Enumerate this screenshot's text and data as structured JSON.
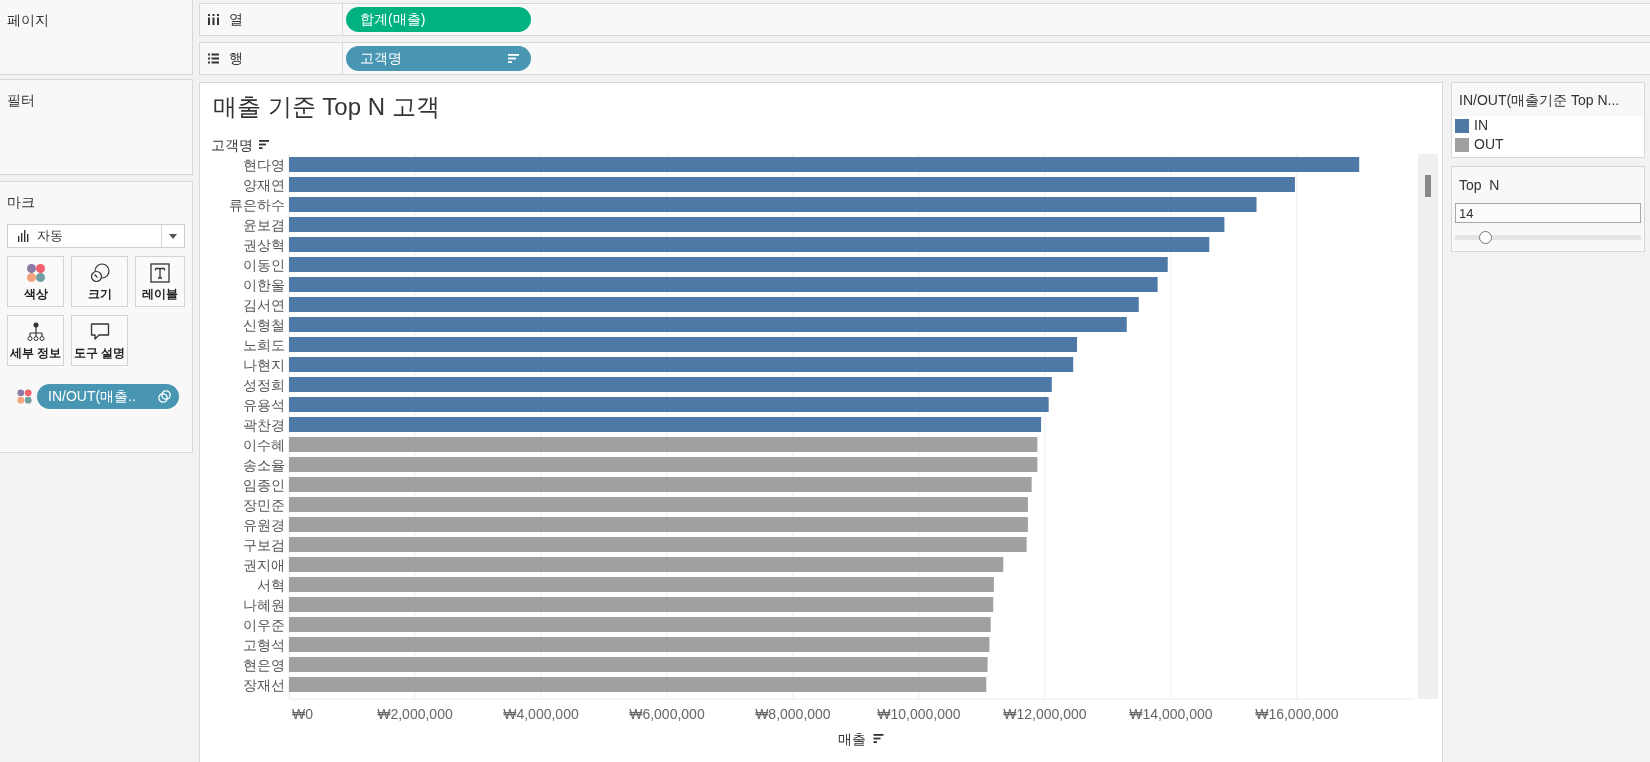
{
  "left_panel": {
    "pages": {
      "title": "페이지"
    },
    "filters": {
      "title": "필터"
    },
    "marks": {
      "title": "마크",
      "mark_type": "자동",
      "cards": [
        {
          "kind": "color",
          "label": "색상"
        },
        {
          "kind": "size",
          "label": "크기"
        },
        {
          "kind": "label",
          "label": "레이블"
        },
        {
          "kind": "detail",
          "label": "세부 정보"
        },
        {
          "kind": "tooltip",
          "label": "도구 설명"
        }
      ],
      "fields": [
        {
          "kind": "color",
          "label": "IN/OUT(매출.."
        }
      ]
    }
  },
  "shelves": [
    {
      "kind": "columns",
      "label": "열",
      "pills": [
        {
          "kind": "measure",
          "label": "합계(매출)",
          "sorted": false
        }
      ]
    },
    {
      "kind": "rows",
      "label": "행",
      "pills": [
        {
          "kind": "dimension",
          "label": "고객명",
          "sorted": true
        }
      ]
    }
  ],
  "view": {
    "chart_data": {
      "type": "bar",
      "orientation": "horizontal",
      "title": "매출 기준 Top N 고객",
      "xlabel": "매출",
      "ylabel": "고객명",
      "categories": [
        "현다영",
        "양재연",
        "류은하수",
        "윤보겸",
        "권상혁",
        "이동인",
        "이한울",
        "김서연",
        "신형철",
        "노희도",
        "나현지",
        "성정희",
        "유용석",
        "곽찬경",
        "이수혜",
        "송소율",
        "임종인",
        "장민준",
        "유원경",
        "구보검",
        "권지애",
        "서혁",
        "나혜원",
        "이우준",
        "고형석",
        "현은영",
        "장재선"
      ],
      "series": [
        {
          "name": "IN",
          "color": "#4e79a7",
          "values": [
            16990000,
            15970000,
            15360000,
            14850000,
            14610000,
            13950000,
            13790000,
            13490000,
            13300000,
            12510000,
            12450000,
            12110000,
            12060000,
            11940000,
            null,
            null,
            null,
            null,
            null,
            null,
            null,
            null,
            null,
            null,
            null,
            null,
            null
          ]
        },
        {
          "name": "OUT",
          "color": "#a0a0a0",
          "values": [
            null,
            null,
            null,
            null,
            null,
            null,
            null,
            null,
            null,
            null,
            null,
            null,
            null,
            null,
            11880000,
            11880000,
            11790000,
            11730000,
            11730000,
            11710000,
            11340000,
            11190000,
            11180000,
            11140000,
            11120000,
            11090000,
            11070000
          ]
        }
      ],
      "stacked": true,
      "grid": true,
      "xlim": [
        0,
        17860000
      ],
      "xticks": [
        {
          "value": 0,
          "label": "₩0"
        },
        {
          "value": 2000000,
          "label": "₩2,000,000"
        },
        {
          "value": 4000000,
          "label": "₩4,000,000"
        },
        {
          "value": 6000000,
          "label": "₩6,000,000"
        },
        {
          "value": 8000000,
          "label": "₩8,000,000"
        },
        {
          "value": 10000000,
          "label": "₩10,000,000"
        },
        {
          "value": 12000000,
          "label": "₩12,000,000"
        },
        {
          "value": 14000000,
          "label": "₩14,000,000"
        },
        {
          "value": 16000000,
          "label": "₩16,000,000"
        }
      ]
    }
  },
  "legend": {
    "title": "IN/OUT(매출기준 Top N..."
  },
  "parameter": {
    "title": "Top  N",
    "value": "14",
    "level": 0.16
  }
}
